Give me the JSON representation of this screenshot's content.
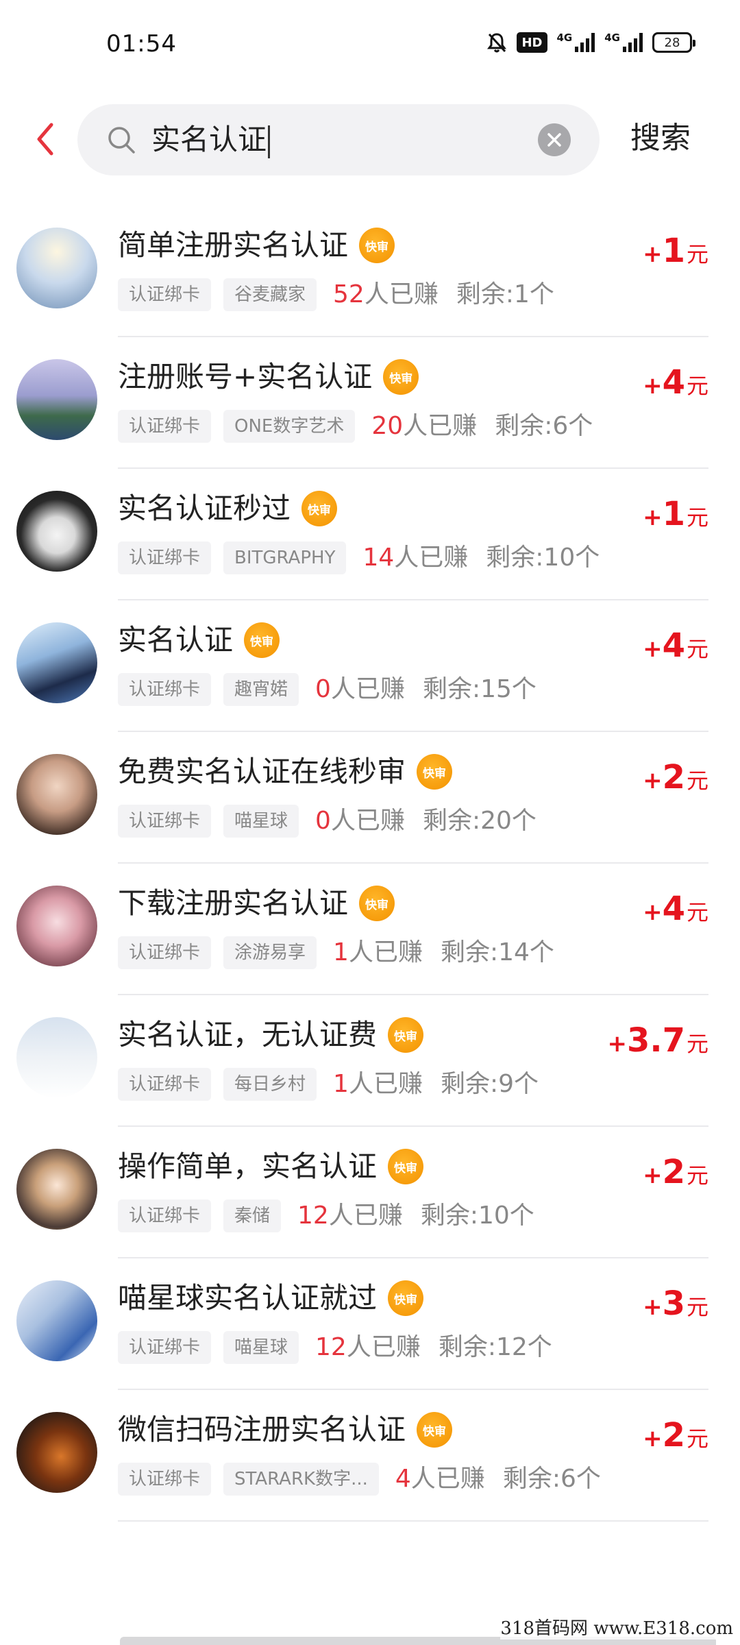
{
  "status_bar": {
    "time": "01:54",
    "hd_label": "HD",
    "signal1_label": "4G",
    "signal2_label": "4G",
    "battery": "28"
  },
  "search": {
    "query": "实名认证",
    "button_label": "搜索"
  },
  "badge_label": "快审",
  "currency_unit": "元",
  "earned_suffix": "人已赚",
  "tasks": [
    {
      "title": "简单注册实名认证",
      "tags": [
        "认证绑卡",
        "谷麦藏家"
      ],
      "earned": "52",
      "remaining": "剩余:1个",
      "reward": "1"
    },
    {
      "title": "注册账号+实名认证",
      "tags": [
        "认证绑卡",
        "ONE数字艺术"
      ],
      "earned": "20",
      "remaining": "剩余:6个",
      "reward": "4"
    },
    {
      "title": "实名认证秒过",
      "tags": [
        "认证绑卡",
        "BITGRAPHY"
      ],
      "earned": "14",
      "remaining": "剩余:10个",
      "reward": "1"
    },
    {
      "title": "实名认证",
      "tags": [
        "认证绑卡",
        "趣宵婼"
      ],
      "earned": "0",
      "remaining": "剩余:15个",
      "reward": "4"
    },
    {
      "title": "免费实名认证在线秒审",
      "tags": [
        "认证绑卡",
        "喵星球"
      ],
      "earned": "0",
      "remaining": "剩余:20个",
      "reward": "2"
    },
    {
      "title": "下载注册实名认证",
      "tags": [
        "认证绑卡",
        "涂游易享"
      ],
      "earned": "1",
      "remaining": "剩余:14个",
      "reward": "4"
    },
    {
      "title": "实名认证，无认证费",
      "tags": [
        "认证绑卡",
        "每日乡村"
      ],
      "earned": "1",
      "remaining": "剩余:9个",
      "reward": "3.7"
    },
    {
      "title": "操作简单，实名认证",
      "tags": [
        "认证绑卡",
        "秦储"
      ],
      "earned": "12",
      "remaining": "剩余:10个",
      "reward": "2"
    },
    {
      "title": "喵星球实名认证就过",
      "tags": [
        "认证绑卡",
        "喵星球"
      ],
      "earned": "12",
      "remaining": "剩余:12个",
      "reward": "3"
    },
    {
      "title": "微信扫码注册实名认证",
      "tags": [
        "认证绑卡",
        "STARARK数字..."
      ],
      "earned": "4",
      "remaining": "剩余:6个",
      "reward": "2"
    }
  ],
  "watermark": "318首码网 www.E318.com",
  "colors": {
    "accent_red": "#e5141e",
    "badge_orange": "#f39200",
    "back_arrow": "#e5343d"
  }
}
